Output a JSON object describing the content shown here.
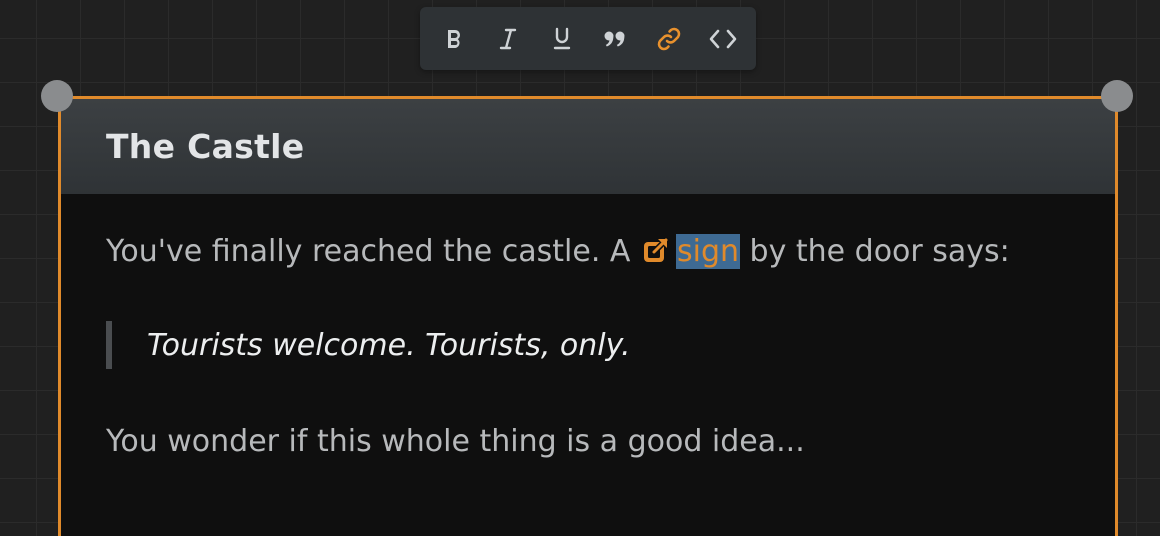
{
  "toolbar": {
    "buttons": [
      {
        "name": "bold",
        "label": "B"
      },
      {
        "name": "italic",
        "label": "I"
      },
      {
        "name": "underline",
        "label": "U"
      },
      {
        "name": "blockquote",
        "icon": "quote-icon"
      },
      {
        "name": "link",
        "icon": "link-icon",
        "active": true
      },
      {
        "name": "code",
        "icon": "code-icon"
      }
    ]
  },
  "passage": {
    "title": "The Castle",
    "paragraph_1_before": "You've finally reached the castle. A ",
    "link_text": "sign",
    "paragraph_1_after": " by the door says:",
    "quote": "Tourists welcome. Tourists, only.",
    "paragraph_2": "You wonder if this whole thing is a good idea..."
  },
  "colors": {
    "accent": "#e08a2b",
    "selection": "#3e6a93",
    "background": "#202020",
    "card_body": "#0f0f0f",
    "header": "#3c4043"
  }
}
